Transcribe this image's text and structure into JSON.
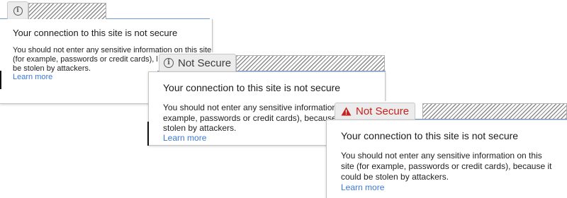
{
  "colors": {
    "omnibox_underline": "#6f9fd8",
    "chip_background": "#ececec",
    "neutral_icon": "#5a5a5a",
    "warning_red": "#c5221f",
    "link_blue": "#3b78d6"
  },
  "panels": [
    {
      "state": "neutral",
      "icon": "info-icon",
      "badge_label": "",
      "title": "Your connection to this site is not secure",
      "body": "You should not enter any sensitive information on this site (for example, passwords or credit cards), because it could be stolen by attackers.",
      "learn_more": "Learn more"
    },
    {
      "state": "neutral",
      "icon": "info-icon",
      "badge_label": "Not Secure",
      "title": "Your connection to this site is not secure",
      "body": "You should not enter any sensitive information on this site (for example, passwords or credit cards), because it could be stolen by attackers.",
      "learn_more": "Learn more"
    },
    {
      "state": "dangerous",
      "icon": "warning-triangle-icon",
      "badge_label": "Not Secure",
      "title": "Your connection to this site is not secure",
      "body": "You should not enter any sensitive information on this site (for example, passwords or credit cards), because it could be stolen by attackers.",
      "learn_more": "Learn more"
    }
  ]
}
